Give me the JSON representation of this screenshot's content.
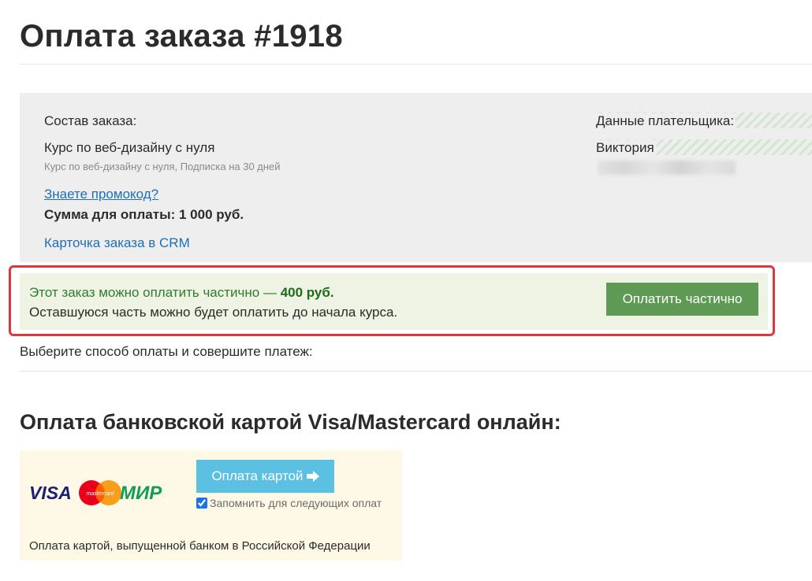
{
  "page": {
    "title": "Оплата заказа #1918"
  },
  "order": {
    "composition_label": "Состав заказа:",
    "item_name": "Курс по веб-дизайну с нуля",
    "item_details": "Курс по веб-дизайну с нуля, Подписка на 30 дней",
    "promo_link": "Знаете промокод?",
    "total": "Сумма для оплаты: 1 000 руб.",
    "crm_link": "Карточка заказа в CRM"
  },
  "payer": {
    "label": "Данные плательщика:",
    "name": "Виктория"
  },
  "partial": {
    "text_prefix": "Этот заказ можно оплатить частично — ",
    "amount": "400 руб.",
    "text_line2": "Оставшуюся часть можно будет оплатить до начала курса.",
    "button_label": "Оплатить частично"
  },
  "choose_method": "Выберите способ оплаты и совершите платеж:",
  "card_payment": {
    "title": "Оплата банковской картой Visa/Mastercard онлайн:",
    "logos": {
      "visa": "VISA",
      "mastercard": "mastercard",
      "mir": "МИР"
    },
    "button_label": "Оплата картой",
    "button_icon": "arrow-right-icon",
    "remember_label": "Запомнить для следующих оплат",
    "remember_checked": true,
    "note": "Оплата картой, выпущенной банком в Российской Федерации"
  },
  "colors": {
    "partial_button": "#5f9a55",
    "card_button": "#5bc0e2",
    "highlight_frame": "#dc3a3a",
    "link": "#1f6fb5"
  }
}
